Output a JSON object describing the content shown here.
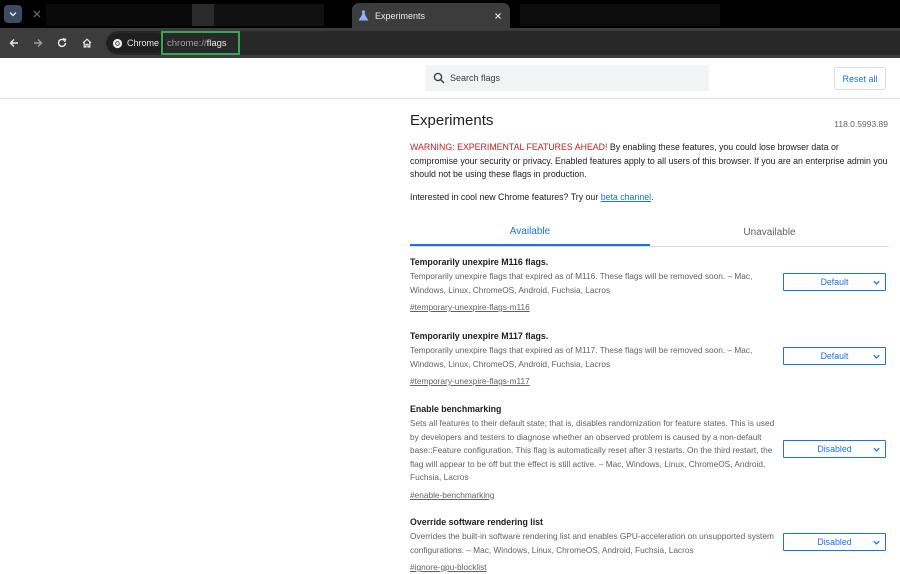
{
  "browser": {
    "tab_title": "Experiments",
    "site_chip": "Chrome",
    "url_scheme": "chrome://",
    "url_path": "flags"
  },
  "icons": {
    "tab_menu": "chevron-down-icon",
    "background_tab_close": "close-icon",
    "tab_favicon": "flask-icon",
    "tab_close": "close-icon",
    "back": "arrow-left-icon",
    "forward": "arrow-right-icon",
    "reload": "reload-icon",
    "home": "home-icon",
    "site": "chrome-logo-icon",
    "search": "search-icon"
  },
  "header": {
    "search_placeholder": "Search flags",
    "reset_label": "Reset all"
  },
  "page": {
    "title": "Experiments",
    "version": "118.0.5993.89",
    "warning_strong": "WARNING: EXPERIMENTAL FEATURES AHEAD!",
    "warning_text": " By enabling these features, you could lose browser data or compromise your security or privacy. Enabled features apply to all users of this browser. If you are an enterprise admin you should not be using these flags in production.",
    "interest_text": "Interested in cool new Chrome features? Try our ",
    "interest_link": "beta channel",
    "interest_end": "."
  },
  "tabs": {
    "available": "Available",
    "unavailable": "Unavailable"
  },
  "flags": [
    {
      "name": "Temporarily unexpire M116 flags.",
      "description": "Temporarily unexpire flags that expired as of M116. These flags will be removed soon. – Mac, Windows, Linux, ChromeOS, Android, Fuchsia, Lacros",
      "link": "#temporary-unexpire-flags-m116",
      "value": "Default"
    },
    {
      "name": "Temporarily unexpire M117 flags.",
      "description": "Temporarily unexpire flags that expired as of M117. These flags will be removed soon. – Mac, Windows, Linux, ChromeOS, Android, Fuchsia, Lacros",
      "link": "#temporary-unexpire-flags-m117",
      "value": "Default"
    },
    {
      "name": "Enable benchmarking",
      "description": "Sets all features to their default state; that is, disables randomization for feature states. This is used by developers and testers to diagnose whether an observed problem is caused by a non-default base::Feature configuration. This flag is automatically reset after 3 restarts. On the third restart, the flag will appear to be off but the effect is still active. – Mac, Windows, Linux, ChromeOS, Android, Fuchsia, Lacros",
      "link": "#enable-benchmarking",
      "value": "Disabled"
    },
    {
      "name": "Override software rendering list",
      "description": "Overrides the built-in software rendering list and enables GPU-acceleration on unsupported system configurations. – Mac, Windows, Linux, ChromeOS, Android, Fuchsia, Lacros",
      "link": "#ignore-gpu-blocklist",
      "value": "Disabled"
    }
  ],
  "colors": {
    "accent": "#1a73e8",
    "warning": "#c5221f",
    "url_highlight": "#34a853"
  }
}
